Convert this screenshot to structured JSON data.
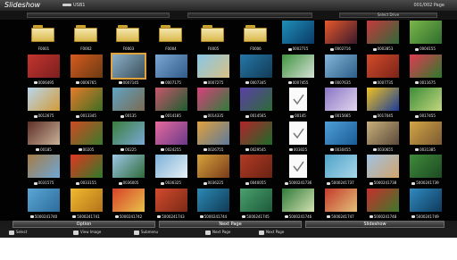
{
  "window": {
    "title": "Slideshow",
    "source": "USB1",
    "page_indicator": "001/002 Page"
  },
  "toolbar": {
    "select_drive": "Select Drive"
  },
  "files": [
    {
      "kind": "folder",
      "label": "F0001"
    },
    {
      "kind": "folder",
      "label": "F0002"
    },
    {
      "kind": "folder",
      "label": "F0003"
    },
    {
      "kind": "folder",
      "label": "F0004"
    },
    {
      "kind": "folder",
      "label": "F0005"
    },
    {
      "kind": "folder",
      "label": "F0006"
    },
    {
      "kind": "image",
      "label": "0002715",
      "colors": [
        "#1e8fb8",
        "#0a3a66"
      ]
    },
    {
      "kind": "image",
      "label": "0002716",
      "colors": [
        "#e7582b",
        "#3a1a2c"
      ]
    },
    {
      "kind": "image",
      "label": "0002853",
      "colors": [
        "#c8383c",
        "#2e6a3a"
      ]
    },
    {
      "kind": "image",
      "label": "0004155",
      "colors": [
        "#7ab648",
        "#2f6d2f"
      ]
    },
    {
      "kind": "image",
      "label": "0006495",
      "colors": [
        "#c4352e",
        "#7a1f1f"
      ]
    },
    {
      "kind": "image",
      "label": "0006765",
      "colors": [
        "#d65b1f",
        "#6b3a12"
      ]
    },
    {
      "kind": "image",
      "label": "0007145",
      "colors": [
        "#8bb0c9",
        "#3b4f5a"
      ],
      "selected": true
    },
    {
      "kind": "image",
      "label": "0007175",
      "colors": [
        "#7ba6d3",
        "#315c8a"
      ]
    },
    {
      "kind": "image",
      "label": "0007275",
      "colors": [
        "#87c7e8",
        "#d9c184"
      ]
    },
    {
      "kind": "image",
      "label": "0007345",
      "colors": [
        "#2577a8",
        "#123b55"
      ]
    },
    {
      "kind": "image",
      "label": "0007455",
      "colors": [
        "#3f9440",
        "#d6e0d6"
      ]
    },
    {
      "kind": "image",
      "label": "0007635",
      "colors": [
        "#82b6d8",
        "#2e5e88"
      ]
    },
    {
      "kind": "image",
      "label": "0007735",
      "colors": [
        "#d24b2b",
        "#7a2418"
      ]
    },
    {
      "kind": "image",
      "label": "0011675",
      "colors": [
        "#e23a52",
        "#2c7a2c"
      ]
    },
    {
      "kind": "image",
      "label": "0012675",
      "colors": [
        "#b8d6ee",
        "#d29b36"
      ]
    },
    {
      "kind": "image",
      "label": "0013345",
      "colors": [
        "#e87b2a",
        "#3d6e23"
      ]
    },
    {
      "kind": "image",
      "label": "00135",
      "colors": [
        "#5fa4c4",
        "#7a6a52"
      ]
    },
    {
      "kind": "image",
      "label": "0014185",
      "colors": [
        "#c9566d",
        "#1b5d2e"
      ]
    },
    {
      "kind": "image",
      "label": "0014335",
      "colors": [
        "#d93f7b",
        "#2e7d3b"
      ]
    },
    {
      "kind": "image",
      "label": "0014565",
      "colors": [
        "#5b3fa8",
        "#2d6b36"
      ]
    },
    {
      "kind": "file",
      "label": "00145"
    },
    {
      "kind": "image",
      "label": "0015665",
      "colors": [
        "#8a74c4",
        "#e1d7ef"
      ]
    },
    {
      "kind": "image",
      "label": "0017045",
      "colors": [
        "#f0c21e",
        "#1a3c9b"
      ]
    },
    {
      "kind": "image",
      "label": "0017455",
      "colors": [
        "#3c8c38",
        "#c2d77e"
      ]
    },
    {
      "kind": "image",
      "label": "00185",
      "colors": [
        "#5f2f27",
        "#c8b29a"
      ]
    },
    {
      "kind": "image",
      "label": "00205",
      "colors": [
        "#d04a22",
        "#3a7a2c"
      ]
    },
    {
      "kind": "image",
      "label": "00225",
      "colors": [
        "#3a7e3d",
        "#7aa8d4"
      ]
    },
    {
      "kind": "image",
      "label": "0024255",
      "colors": [
        "#e66a9d",
        "#6a3a8a"
      ]
    },
    {
      "kind": "image",
      "label": "0026755",
      "colors": [
        "#e1a13c",
        "#5d7a9c"
      ]
    },
    {
      "kind": "image",
      "label": "0029545",
      "colors": [
        "#b32329",
        "#1d6b2a"
      ]
    },
    {
      "kind": "file",
      "label": "003025"
    },
    {
      "kind": "image",
      "label": "0030455",
      "colors": [
        "#4f9ed6",
        "#1a5c96"
      ]
    },
    {
      "kind": "image",
      "label": "0030655",
      "colors": [
        "#c9b07a",
        "#5b4a3a"
      ]
    },
    {
      "kind": "image",
      "label": "0031385",
      "colors": [
        "#d4a544",
        "#7b5a33"
      ]
    },
    {
      "kind": "image",
      "label": "0031575",
      "colors": [
        "#a57b45",
        "#6ea7d8"
      ]
    },
    {
      "kind": "image",
      "label": "0033155",
      "colors": [
        "#e2361f",
        "#2e7c2a"
      ]
    },
    {
      "kind": "image",
      "label": "0036005",
      "colors": [
        "#9ec7e8",
        "#2f6b3a"
      ]
    },
    {
      "kind": "image",
      "label": "0036325",
      "colors": [
        "#7cb1d8",
        "#e9f0f5"
      ]
    },
    {
      "kind": "image",
      "label": "0036225",
      "colors": [
        "#d6a33a",
        "#7a3a1a"
      ]
    },
    {
      "kind": "image",
      "label": "0040055",
      "colors": [
        "#b23b24",
        "#6a2214"
      ]
    },
    {
      "kind": "file",
      "label": "5000241736"
    },
    {
      "kind": "image",
      "label": "5000241737",
      "colors": [
        "#4fa3c9",
        "#a9d7e8"
      ]
    },
    {
      "kind": "image",
      "label": "5000241738",
      "colors": [
        "#9fc3e2",
        "#d3a36d"
      ]
    },
    {
      "kind": "image",
      "label": "5000241739",
      "colors": [
        "#3e8a3a",
        "#1d4a22"
      ]
    },
    {
      "kind": "image",
      "label": "5000241740",
      "colors": [
        "#5aa6d6",
        "#2d6c9a"
      ]
    },
    {
      "kind": "image",
      "label": "5000241741",
      "colors": [
        "#f0b92e",
        "#b3741a"
      ]
    },
    {
      "kind": "image",
      "label": "5000241742",
      "colors": [
        "#d8402a",
        "#e8c34a"
      ]
    },
    {
      "kind": "image",
      "label": "5000241743",
      "colors": [
        "#d24a2e",
        "#7a2a16"
      ]
    },
    {
      "kind": "image",
      "label": "5000241744",
      "colors": [
        "#2b8ab5",
        "#103a55"
      ]
    },
    {
      "kind": "image",
      "label": "5000241745",
      "colors": [
        "#4aa06e",
        "#1d5a3a"
      ]
    },
    {
      "kind": "image",
      "label": "5000241746",
      "colors": [
        "#2f7a3a",
        "#d2e2b0"
      ]
    },
    {
      "kind": "image",
      "label": "5000241747",
      "colors": [
        "#c43a2a",
        "#e2c07a"
      ]
    },
    {
      "kind": "image",
      "label": "5000241748",
      "colors": [
        "#c82e2e",
        "#3c7a2a"
      ]
    },
    {
      "kind": "image",
      "label": "5000241749",
      "colors": [
        "#2f8ac0",
        "#0f3a5c"
      ]
    }
  ],
  "bottom_bar": {
    "option": "Option",
    "next_page": "Next Page",
    "slideshow": "Slideshow"
  },
  "keys": [
    {
      "icon": "enter-key-icon",
      "label": "Select"
    },
    {
      "icon": "edit-key-icon",
      "label": "View Image"
    },
    {
      "icon": "esc-key-icon",
      "label": "Submenu"
    },
    {
      "icon": "page-key-icon",
      "label": "Next Page"
    },
    {
      "icon": "page-key-icon",
      "label": "Next Page"
    }
  ]
}
